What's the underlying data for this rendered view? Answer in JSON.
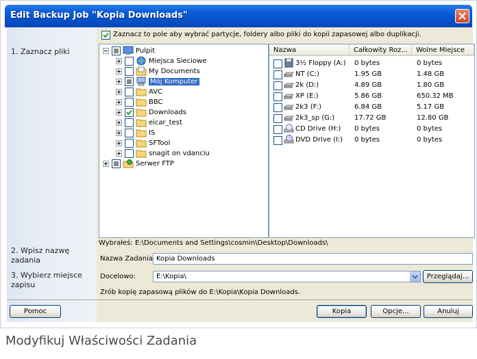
{
  "window": {
    "title": "Edit Backup Job \"Kopia Downloads\"",
    "top_label": "Zaznacz to pole aby wybrać partycje, foldery albo pliki do kopii zapasowej albo duplikacji."
  },
  "steps": [
    "1. Zaznacz pliki",
    "2. Wpisz nazwę zadania",
    "3. Wybierz miejsce zapisu"
  ],
  "tree": [
    {
      "label": "Pulpit",
      "level": 0,
      "expander": "minus",
      "check": "partial",
      "icon": "desktop-icon"
    },
    {
      "label": "Miejsca Sieciowe",
      "level": 1,
      "expander": "plus",
      "check": "empty",
      "icon": "network-places-icon"
    },
    {
      "label": "My Documents",
      "level": 1,
      "expander": "plus",
      "check": "empty",
      "icon": "my-documents-icon"
    },
    {
      "label": "Mój Komputer",
      "level": 1,
      "expander": "plus",
      "check": "partial",
      "icon": "my-computer-icon",
      "selected": true
    },
    {
      "label": "AVC",
      "level": 1,
      "expander": "plus",
      "check": "empty",
      "icon": "folder-icon"
    },
    {
      "label": "BBC",
      "level": 1,
      "expander": "plus",
      "check": "empty",
      "icon": "folder-icon"
    },
    {
      "label": "Downloads",
      "level": 1,
      "expander": "plus",
      "check": "checked",
      "icon": "folder-icon"
    },
    {
      "label": "eicar_test",
      "level": 1,
      "expander": "plus",
      "check": "empty",
      "icon": "folder-icon"
    },
    {
      "label": "IS",
      "level": 1,
      "expander": "plus",
      "check": "empty",
      "icon": "folder-icon"
    },
    {
      "label": "SFTool",
      "level": 1,
      "expander": "plus",
      "check": "empty",
      "icon": "folder-icon"
    },
    {
      "label": "snagit on vdanciu",
      "level": 1,
      "expander": "plus",
      "check": "empty",
      "icon": "folder-icon"
    },
    {
      "label": "Serwer FTP",
      "level": 0,
      "expander": "plus",
      "check": "partial",
      "icon": "ftp-server-icon"
    }
  ],
  "drives": {
    "columns": [
      "Nazwa",
      "Całkowity Roz...",
      "Wolne Miejsce"
    ],
    "rows": [
      {
        "name": "3½ Floppy (A:)",
        "total": "0 bytes",
        "free": "0 bytes",
        "icon": "floppy-icon"
      },
      {
        "name": "NT (C:)",
        "total": "1.95 GB",
        "free": "1.48 GB",
        "icon": "hard-drive-icon"
      },
      {
        "name": "2k (D:)",
        "total": "4.89 GB",
        "free": "1.80 GB",
        "icon": "hard-drive-icon"
      },
      {
        "name": "XP (E:)",
        "total": "5.86 GB",
        "free": "650.32 MB",
        "icon": "hard-drive-icon"
      },
      {
        "name": "2k3 (F:)",
        "total": "6.84 GB",
        "free": "5.17 GB",
        "icon": "hard-drive-icon"
      },
      {
        "name": "2k3_sp (G:)",
        "total": "17.72 GB",
        "free": "12.80 GB",
        "icon": "hard-drive-icon"
      },
      {
        "name": "CD Drive (H:)",
        "total": "0 bytes",
        "free": "0 bytes",
        "icon": "cd-drive-icon"
      },
      {
        "name": "DVD Drive (I:)",
        "total": "0 bytes",
        "free": "0 bytes",
        "icon": "dvd-drive-icon"
      }
    ]
  },
  "selected_path": "Wybrałeś: E:\\Documents and Settings\\cosmin\\Desktop\\Downloads\\",
  "job_name": {
    "label": "Nazwa Zadania:",
    "value": "Kopia Downloads"
  },
  "destination": {
    "label": "Docelowo:",
    "value": "E:\\Kopia\\",
    "browse_label": "Przeglądaj..."
  },
  "summary": "Zrób kopię zapasową plików do E:\\Kopia\\Kopia Downloads.",
  "buttons": {
    "help": "Pomoc",
    "backup": "Kopia",
    "options": "Opcje...",
    "cancel": "Anuluj"
  },
  "caption": "Modyfikuj Właściwości Zadania"
}
